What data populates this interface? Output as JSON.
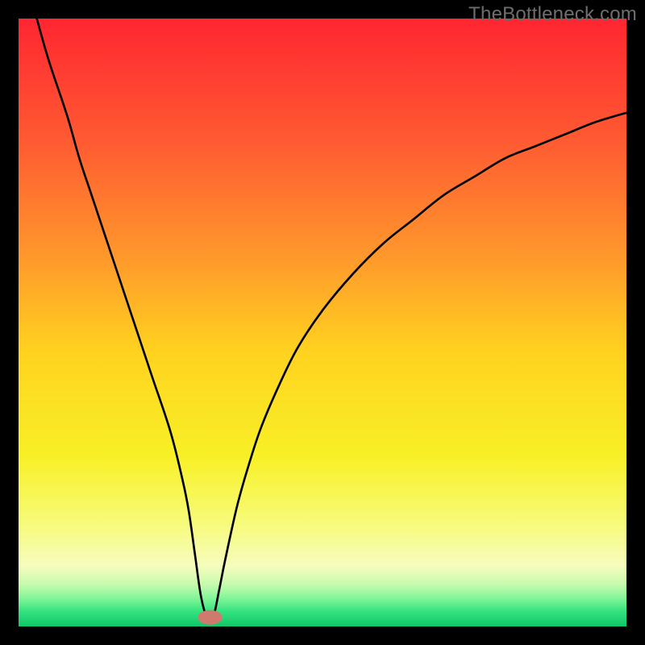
{
  "watermark": "TheBottleneck.com",
  "chart_data": {
    "type": "line",
    "title": "",
    "xlabel": "",
    "ylabel": "",
    "xlim": [
      0,
      100
    ],
    "ylim": [
      0,
      100
    ],
    "x": [
      3,
      5,
      8,
      10,
      12,
      15,
      18,
      20,
      22,
      25,
      27,
      28,
      29,
      30,
      31,
      32,
      33,
      34,
      36,
      38,
      40,
      43,
      46,
      50,
      55,
      60,
      65,
      70,
      75,
      80,
      85,
      90,
      95,
      100
    ],
    "values": [
      100,
      93,
      84,
      77,
      71,
      62,
      53,
      47,
      41,
      32,
      24,
      19,
      12,
      5,
      1.5,
      1.5,
      6,
      11,
      20,
      27,
      33,
      40,
      46,
      52,
      58,
      63,
      67,
      71,
      74,
      77,
      79,
      81,
      83,
      84.5
    ],
    "marker": {
      "x": 31.5,
      "y": 1.5,
      "color": "#d07a6e",
      "rx": 2.0,
      "ry": 1.2
    },
    "background_gradient": {
      "stops": [
        {
          "offset": 0.0,
          "color": "#ff2631"
        },
        {
          "offset": 0.2,
          "color": "#ff5a32"
        },
        {
          "offset": 0.4,
          "color": "#ff9b2b"
        },
        {
          "offset": 0.55,
          "color": "#ffd31f"
        },
        {
          "offset": 0.72,
          "color": "#f8f026"
        },
        {
          "offset": 0.83,
          "color": "#f7fb7a"
        },
        {
          "offset": 0.9,
          "color": "#f6fcbd"
        },
        {
          "offset": 0.93,
          "color": "#c8fbaf"
        },
        {
          "offset": 0.955,
          "color": "#7ef597"
        },
        {
          "offset": 0.975,
          "color": "#34e37f"
        },
        {
          "offset": 1.0,
          "color": "#10c768"
        }
      ]
    }
  }
}
